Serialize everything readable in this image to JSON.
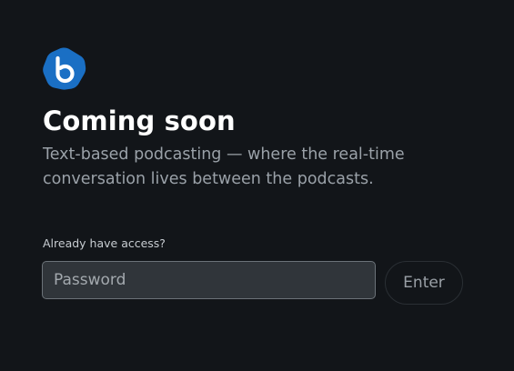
{
  "brand": {
    "logo_icon": "bing-b-logo-icon",
    "logo_color": "#1a6fc4"
  },
  "hero": {
    "title": "Coming soon",
    "subtitle": "Text-based podcasting — where the real-time conversation lives between the podcasts."
  },
  "access": {
    "label": "Already have access?",
    "password_placeholder": "Password",
    "password_value": "",
    "enter_label": "Enter"
  },
  "colors": {
    "background": "#121519",
    "title": "#ffffff",
    "subtitle": "#9aa1a8",
    "input_bg": "#30353a",
    "input_border": "#6b7278"
  }
}
